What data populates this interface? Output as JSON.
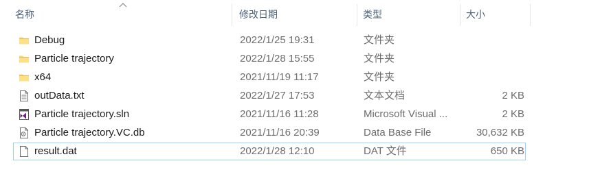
{
  "columns": {
    "name": "名称",
    "date": "修改日期",
    "type": "类型",
    "size": "大小"
  },
  "files": [
    {
      "name": "Debug",
      "date": "2022/1/25 19:31",
      "type": "文件夹",
      "size": "",
      "icon": "folder-icon"
    },
    {
      "name": "Particle trajectory",
      "date": "2022/1/28 15:55",
      "type": "文件夹",
      "size": "",
      "icon": "folder-icon"
    },
    {
      "name": "x64",
      "date": "2021/11/19 11:17",
      "type": "文件夹",
      "size": "",
      "icon": "folder-icon"
    },
    {
      "name": "outData.txt",
      "date": "2022/1/27 17:53",
      "type": "文本文档",
      "size": "2 KB",
      "icon": "text-file-icon"
    },
    {
      "name": "Particle trajectory.sln",
      "date": "2021/11/16 11:28",
      "type": "Microsoft Visual ...",
      "size": "2 KB",
      "icon": "visual-studio-solution-icon"
    },
    {
      "name": "Particle trajectory.VC.db",
      "date": "2021/11/16 20:39",
      "type": "Data Base File",
      "size": "30,632 KB",
      "icon": "database-file-icon"
    },
    {
      "name": "result.dat",
      "date": "2022/1/28 12:10",
      "type": "DAT 文件",
      "size": "650 KB",
      "icon": "blank-file-icon"
    }
  ],
  "focused_row": 6,
  "colors": {
    "folder": "#f8d775",
    "focus_border": "#99d1ff",
    "vs_purple": "#68217a"
  }
}
